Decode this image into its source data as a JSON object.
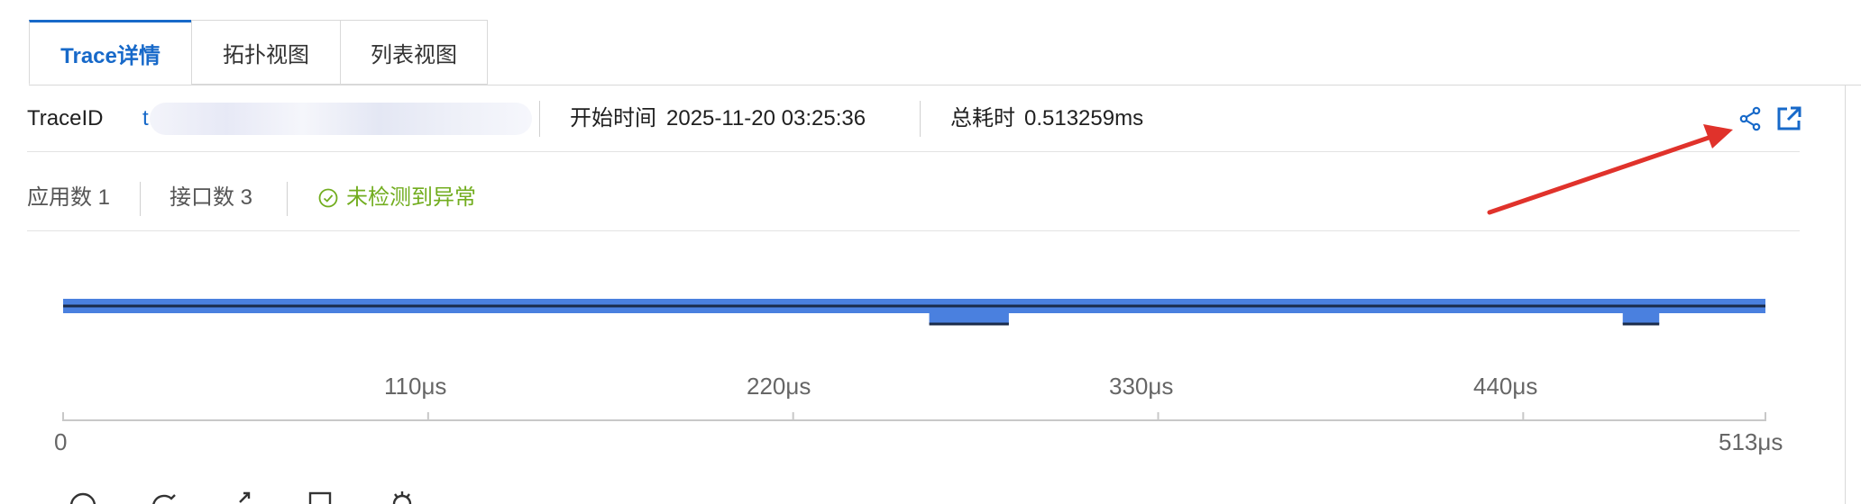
{
  "tabs": [
    {
      "label": "Trace详情",
      "active": true
    },
    {
      "label": "拓扑视图",
      "active": false
    },
    {
      "label": "列表视图",
      "active": false
    }
  ],
  "trace": {
    "id_label": "TraceID",
    "id_value": "t",
    "start_label": "开始时间",
    "start_value": "2025-11-20 03:25:36",
    "duration_label": "总耗时",
    "duration_value": "0.513259ms"
  },
  "stats": {
    "apps": "应用数 1",
    "interfaces": "接口数 3",
    "status": "未检测到异常"
  },
  "timeline": {
    "ticks": [
      "0",
      "110μs",
      "220μs",
      "330μs",
      "440μs",
      "513μs"
    ],
    "bar_color": "#4a80df",
    "spans": [
      {
        "start": 0,
        "end": 513
      },
      {
        "start": 261,
        "end": 285
      },
      {
        "start": 470,
        "end": 481
      }
    ]
  },
  "colors": {
    "accent": "#1769c9",
    "ok": "#72ad1f",
    "annotation": "#e0322b"
  }
}
